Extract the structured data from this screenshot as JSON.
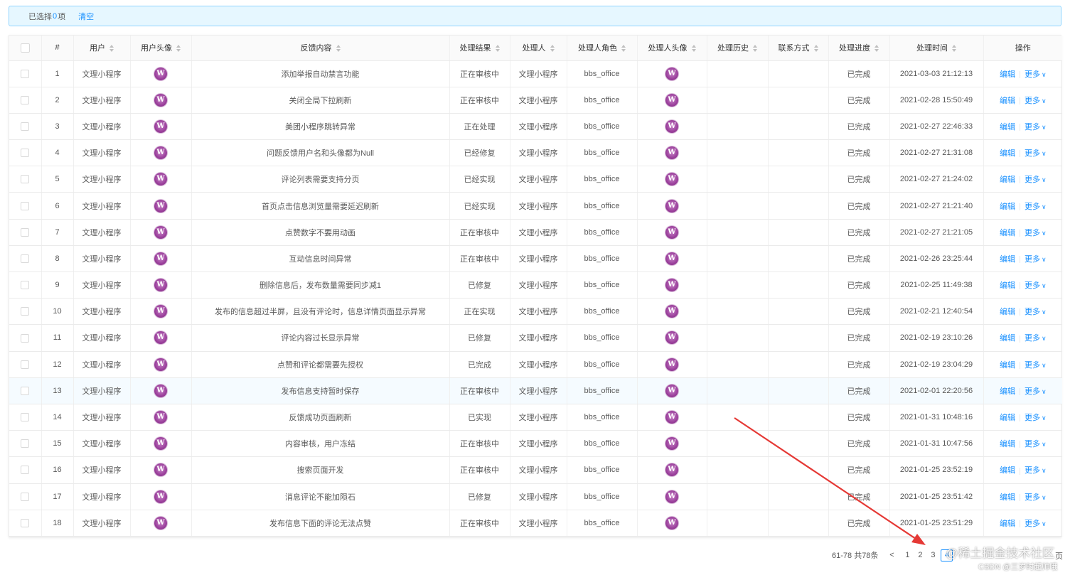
{
  "selection": {
    "prefix": "已选择",
    "count": "0",
    "suffix": "项",
    "clear_label": "清空"
  },
  "table": {
    "columns": [
      "#",
      "用户",
      "用户头像",
      "反馈内容",
      "处理结果",
      "处理人",
      "处理人角色",
      "处理人头像",
      "处理历史",
      "联系方式",
      "处理进度",
      "处理时间",
      "操作"
    ],
    "rows": [
      {
        "no": "1",
        "user": "文理小程序",
        "content": "添加举报自动禁言功能",
        "result": "正在审核中",
        "handler": "文理小程序",
        "role": "bbs_office",
        "progress": "已完成",
        "time": "2021-03-03 21:12:13"
      },
      {
        "no": "2",
        "user": "文理小程序",
        "content": "关闭全局下拉刷新",
        "result": "正在审核中",
        "handler": "文理小程序",
        "role": "bbs_office",
        "progress": "已完成",
        "time": "2021-02-28 15:50:49"
      },
      {
        "no": "3",
        "user": "文理小程序",
        "content": "美团小程序跳转异常",
        "result": "正在处理",
        "handler": "文理小程序",
        "role": "bbs_office",
        "progress": "已完成",
        "time": "2021-02-27 22:46:33"
      },
      {
        "no": "4",
        "user": "文理小程序",
        "content": "问题反馈用户名和头像都为Null",
        "result": "已经修复",
        "handler": "文理小程序",
        "role": "bbs_office",
        "progress": "已完成",
        "time": "2021-02-27 21:31:08"
      },
      {
        "no": "5",
        "user": "文理小程序",
        "content": "评论列表需要支持分页",
        "result": "已经实现",
        "handler": "文理小程序",
        "role": "bbs_office",
        "progress": "已完成",
        "time": "2021-02-27 21:24:02"
      },
      {
        "no": "6",
        "user": "文理小程序",
        "content": "首页点击信息浏览量需要延迟刷新",
        "result": "已经实现",
        "handler": "文理小程序",
        "role": "bbs_office",
        "progress": "已完成",
        "time": "2021-02-27 21:21:40"
      },
      {
        "no": "7",
        "user": "文理小程序",
        "content": "点赞数字不要用动画",
        "result": "正在审核中",
        "handler": "文理小程序",
        "role": "bbs_office",
        "progress": "已完成",
        "time": "2021-02-27 21:21:05"
      },
      {
        "no": "8",
        "user": "文理小程序",
        "content": "互动信息时间异常",
        "result": "正在审核中",
        "handler": "文理小程序",
        "role": "bbs_office",
        "progress": "已完成",
        "time": "2021-02-26 23:25:44"
      },
      {
        "no": "9",
        "user": "文理小程序",
        "content": "删除信息后，发布数量需要同步减1",
        "result": "已修复",
        "handler": "文理小程序",
        "role": "bbs_office",
        "progress": "已完成",
        "time": "2021-02-25 11:49:38"
      },
      {
        "no": "10",
        "user": "文理小程序",
        "content": "发布的信息超过半屏，且没有评论时，信息详情页面显示异常",
        "result": "正在实现",
        "handler": "文理小程序",
        "role": "bbs_office",
        "progress": "已完成",
        "time": "2021-02-21 12:40:54"
      },
      {
        "no": "11",
        "user": "文理小程序",
        "content": "评论内容过长显示异常",
        "result": "已修复",
        "handler": "文理小程序",
        "role": "bbs_office",
        "progress": "已完成",
        "time": "2021-02-19 23:10:26"
      },
      {
        "no": "12",
        "user": "文理小程序",
        "content": "点赞和评论都需要先授权",
        "result": "已完成",
        "handler": "文理小程序",
        "role": "bbs_office",
        "progress": "已完成",
        "time": "2021-02-19 23:04:29"
      },
      {
        "no": "13",
        "user": "文理小程序",
        "content": "发布信息支持暂时保存",
        "result": "正在审核中",
        "handler": "文理小程序",
        "role": "bbs_office",
        "progress": "已完成",
        "time": "2021-02-01 22:20:56"
      },
      {
        "no": "14",
        "user": "文理小程序",
        "content": "反馈成功页面刷新",
        "result": "已实现",
        "handler": "文理小程序",
        "role": "bbs_office",
        "progress": "已完成",
        "time": "2021-01-31 10:48:16"
      },
      {
        "no": "15",
        "user": "文理小程序",
        "content": "内容审核，用户冻结",
        "result": "正在审核中",
        "handler": "文理小程序",
        "role": "bbs_office",
        "progress": "已完成",
        "time": "2021-01-31 10:47:56"
      },
      {
        "no": "16",
        "user": "文理小程序",
        "content": "搜索页面开发",
        "result": "正在审核中",
        "handler": "文理小程序",
        "role": "bbs_office",
        "progress": "已完成",
        "time": "2021-01-25 23:52:19"
      },
      {
        "no": "17",
        "user": "文理小程序",
        "content": "消息评论不能加陨石",
        "result": "已修复",
        "handler": "文理小程序",
        "role": "bbs_office",
        "progress": "已完成",
        "time": "2021-01-25 23:51:42"
      },
      {
        "no": "18",
        "user": "文理小程序",
        "content": "发布信息下面的评论无法点赞",
        "result": "正在审核中",
        "handler": "文理小程序",
        "role": "bbs_office",
        "progress": "已完成",
        "time": "2021-01-25 23:51:29"
      }
    ],
    "highlighted_row": "13",
    "actions": {
      "edit": "编辑",
      "more": "更多"
    },
    "avatar_letter": "W"
  },
  "pagination": {
    "total_text": "61-78 共78条",
    "prev": "<",
    "pages": [
      "1",
      "2",
      "3",
      "4"
    ],
    "current": "4",
    "trailing_text": "页"
  },
  "watermark": {
    "main": "@稀土掘金技术社区",
    "sub": "CSDN @三岁时超帅哦"
  },
  "colors": {
    "accent": "#1890ff",
    "annotation_arrow": "#e53935",
    "avatar": "#9a3f9b"
  }
}
